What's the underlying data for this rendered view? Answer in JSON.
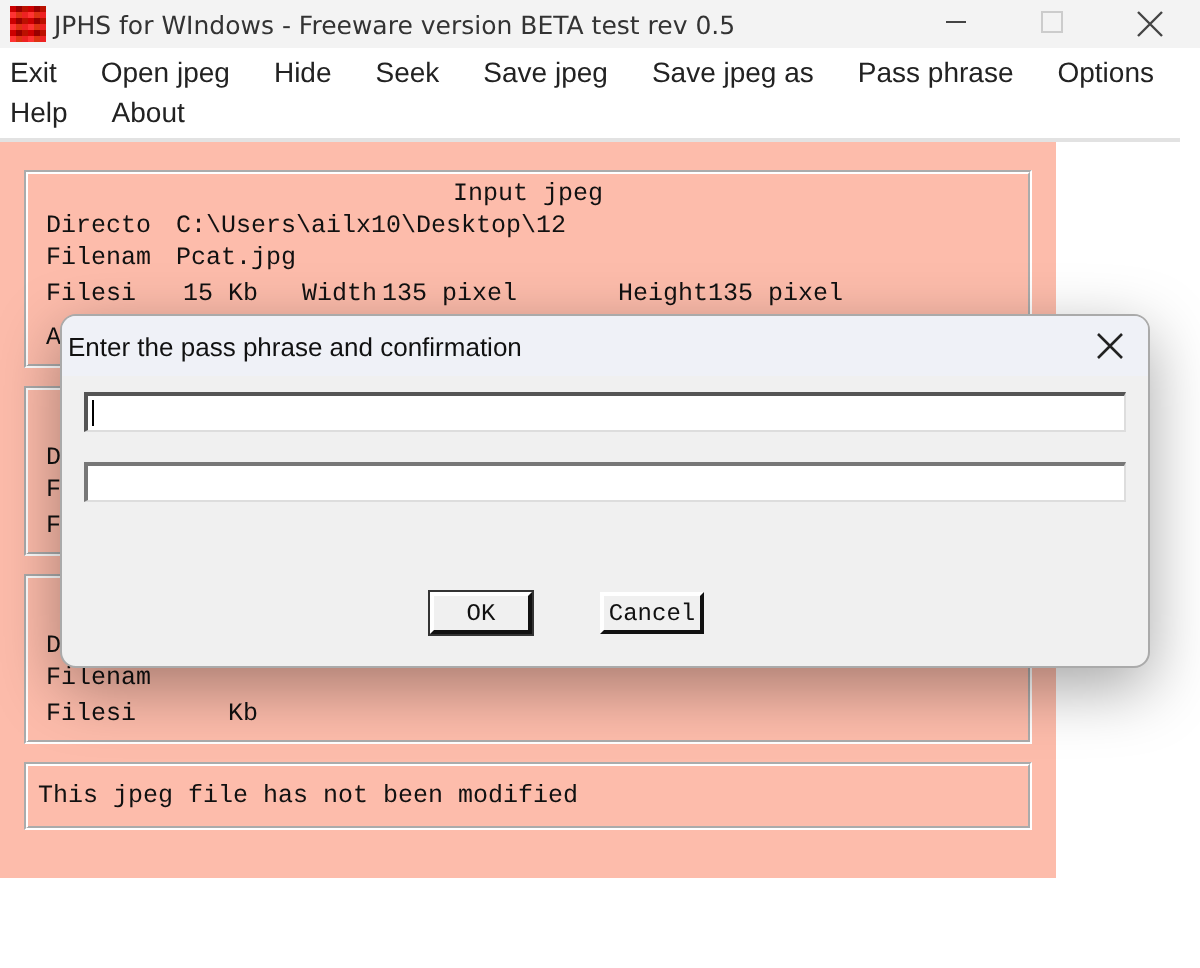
{
  "window": {
    "title": "JPHS for WIndows - Freeware version BETA test rev 0.5",
    "maximize_disabled": true
  },
  "menu": [
    "Exit",
    "Open jpeg",
    "Hide",
    "Seek",
    "Save jpeg",
    "Save jpeg as",
    "Pass phrase",
    "Options",
    "Help",
    "About"
  ],
  "panels": [
    {
      "title": "Input jpeg",
      "rows": [
        {
          "cells": [
            "Directo",
            "C:\\Users\\ailx10\\Desktop\\12"
          ]
        },
        {
          "cells": [
            "Filenam",
            "Pcat.jpg"
          ]
        },
        {
          "cells": [
            "Filesi",
            "15 Kb",
            "Width",
            "135 pixel",
            "Height",
            "135 pixel"
          ]
        },
        {
          "cells": [
            "A"
          ]
        }
      ]
    },
    {
      "rows": [
        {
          "cells": [
            "D"
          ]
        },
        {
          "cells": [
            "F"
          ]
        },
        {
          "cells": [
            "F"
          ]
        }
      ]
    },
    {
      "rows": [
        {
          "cells": [
            "D"
          ]
        },
        {
          "cells": [
            "Filenam"
          ]
        },
        {
          "cells": [
            "Filesi",
            "Kb"
          ]
        }
      ]
    }
  ],
  "status": "This jpeg file has not been modified",
  "dialog": {
    "title": "Enter the pass phrase and confirmation",
    "fields": [
      {
        "focused": true
      },
      {
        "focused": false
      }
    ],
    "buttons": [
      {
        "label": "OK",
        "default": true
      },
      {
        "label": "Cancel",
        "default": false
      }
    ]
  }
}
